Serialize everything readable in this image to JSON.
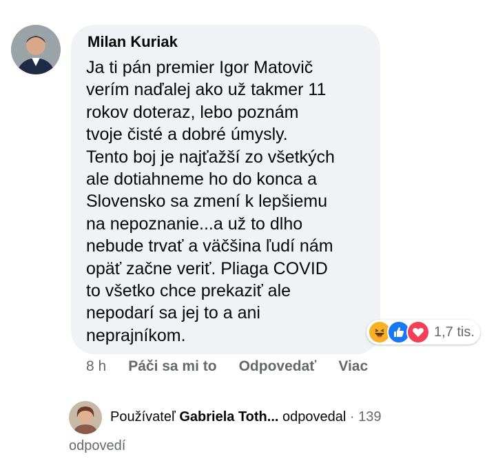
{
  "comment": {
    "author": "Milan Kuriak",
    "lines": [
      "Ja ti pán premier Igor Matovič",
      "verím naďalej ako už takmer 11",
      "rokov doteraz, lebo poznám",
      "tvoje čisté a dobré úmysly.",
      "Tento boj je najťažší zo všetkých",
      "ale dotiahneme ho do konca a",
      "Slovensko sa zmení k lepšiemu",
      "na nepoznanie...a už to dlho",
      "nebude trvať a väčšina ľudí nám",
      "opäť začne veriť. Pliaga COVID",
      "to všetko chce prekaziť ale",
      "nepodarí sa jej to a ani",
      "neprajníkom."
    ],
    "reaction_count": "1,7 tis.",
    "reactions": [
      "haha-icon",
      "like-icon",
      "love-icon"
    ]
  },
  "actions": {
    "time": "8 h",
    "like": "Páči sa mi to",
    "reply": "Odpovedať",
    "more": "Viac"
  },
  "reply_summary": {
    "prefix": "Používateľ",
    "name": "Gabriela Toth...",
    "verb": "odpovedal",
    "separator": "·",
    "count": "139",
    "suffix": "odpovedí"
  },
  "colors": {
    "bubble": "#f0f2f5",
    "secondary_text": "#65676b",
    "like_blue": "#1877f2",
    "love_red": "#f33e58",
    "haha_yellow": "#f7b125"
  }
}
